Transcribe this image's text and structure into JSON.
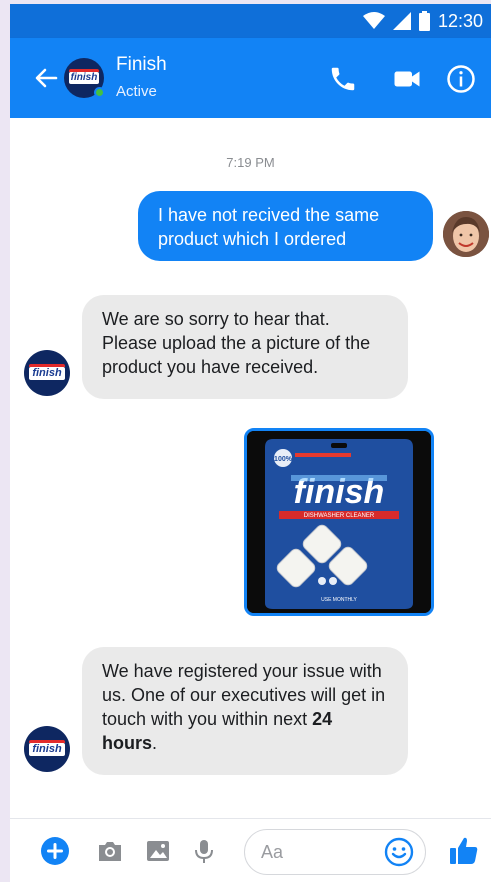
{
  "status_bar": {
    "time": "12:30"
  },
  "header": {
    "contact_name": "Finish",
    "contact_status": "Active",
    "avatar_logo_text": "finish"
  },
  "thread": {
    "timestamp": "7:19 PM",
    "messages": [
      {
        "sender": "user",
        "text": "I have not recived the same product which I ordered"
      },
      {
        "sender": "brand",
        "text": "We are so sorry to hear that. Please upload the a picture of the product you have received."
      },
      {
        "sender": "user",
        "type": "image",
        "image_text": {
          "badge": "100%",
          "brand": "finish",
          "product": "DISHWASHER CLEANER",
          "footer": "USE MONTHLY"
        }
      },
      {
        "sender": "brand",
        "text_before": "We have registered your issue with us. One of our executives will get in touch with you within next ",
        "text_bold": "24 hours",
        "text_after": "."
      }
    ]
  },
  "composer": {
    "placeholder": "Aa"
  },
  "colors": {
    "brand_blue": "#1283f5",
    "status_bar": "#0f6fd9",
    "incoming_bubble": "#eaeaea",
    "online": "#43c141"
  }
}
